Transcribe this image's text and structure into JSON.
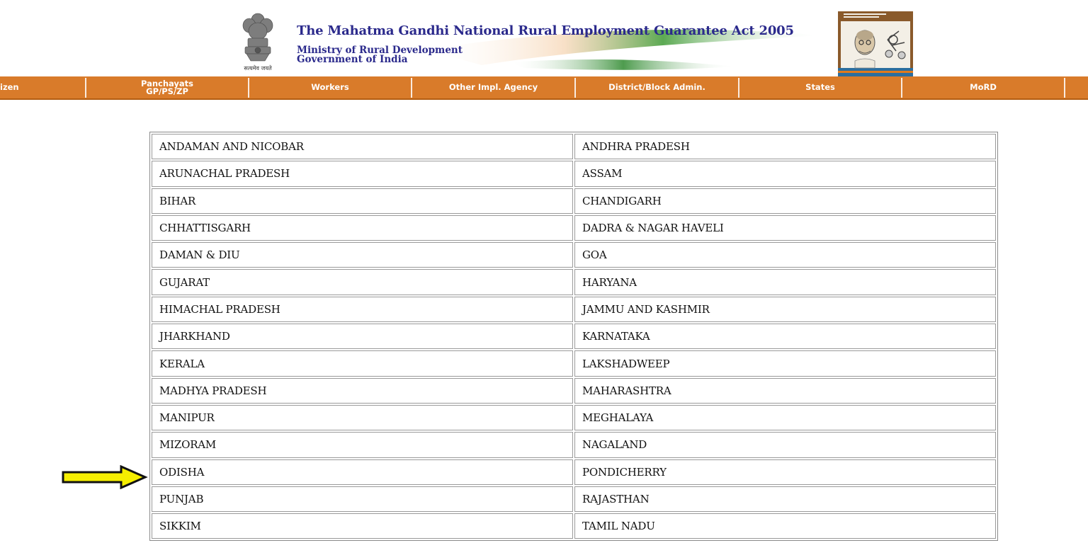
{
  "header": {
    "title": "The Mahatma Gandhi National Rural Employment Guarantee Act 2005",
    "ministry": "Ministry of Rural Development",
    "government": "Government of India",
    "emblem_motto": "सत्यमेव जयते"
  },
  "nav": {
    "items": [
      {
        "label": "izen"
      },
      {
        "label": "Panchayats",
        "label2": "GP/PS/ZP"
      },
      {
        "label": "Workers"
      },
      {
        "label": "Other Impl. Agency"
      },
      {
        "label": "District/Block Admin."
      },
      {
        "label": "States"
      },
      {
        "label": "MoRD"
      }
    ]
  },
  "states": {
    "rows": [
      [
        "ANDAMAN AND NICOBAR",
        "ANDHRA PRADESH"
      ],
      [
        "ARUNACHAL PRADESH",
        "ASSAM"
      ],
      [
        "BIHAR",
        "CHANDIGARH"
      ],
      [
        "CHHATTISGARH",
        "DADRA & NAGAR HAVELI"
      ],
      [
        "DAMAN & DIU",
        "GOA"
      ],
      [
        "GUJARAT",
        "HARYANA"
      ],
      [
        "HIMACHAL PRADESH",
        "JAMMU AND KASHMIR"
      ],
      [
        "JHARKHAND",
        "KARNATAKA"
      ],
      [
        "KERALA",
        "LAKSHADWEEP"
      ],
      [
        "MADHYA PRADESH",
        "MAHARASHTRA"
      ],
      [
        "MANIPUR",
        "MEGHALAYA"
      ],
      [
        "MIZORAM",
        "NAGALAND"
      ],
      [
        "ODISHA",
        "PONDICHERRY"
      ],
      [
        "PUNJAB",
        "RAJASTHAN"
      ],
      [
        "SIKKIM",
        "TAMIL NADU"
      ]
    ]
  },
  "colors": {
    "nav_bg": "#d97b2a",
    "title": "#2b2a8c",
    "arrow_fill": "#f5ee00"
  },
  "icons": {
    "emblem": "national-emblem-icon",
    "logo": "mahatma-gandhi-logo",
    "pointer": "yellow-arrow-icon"
  }
}
